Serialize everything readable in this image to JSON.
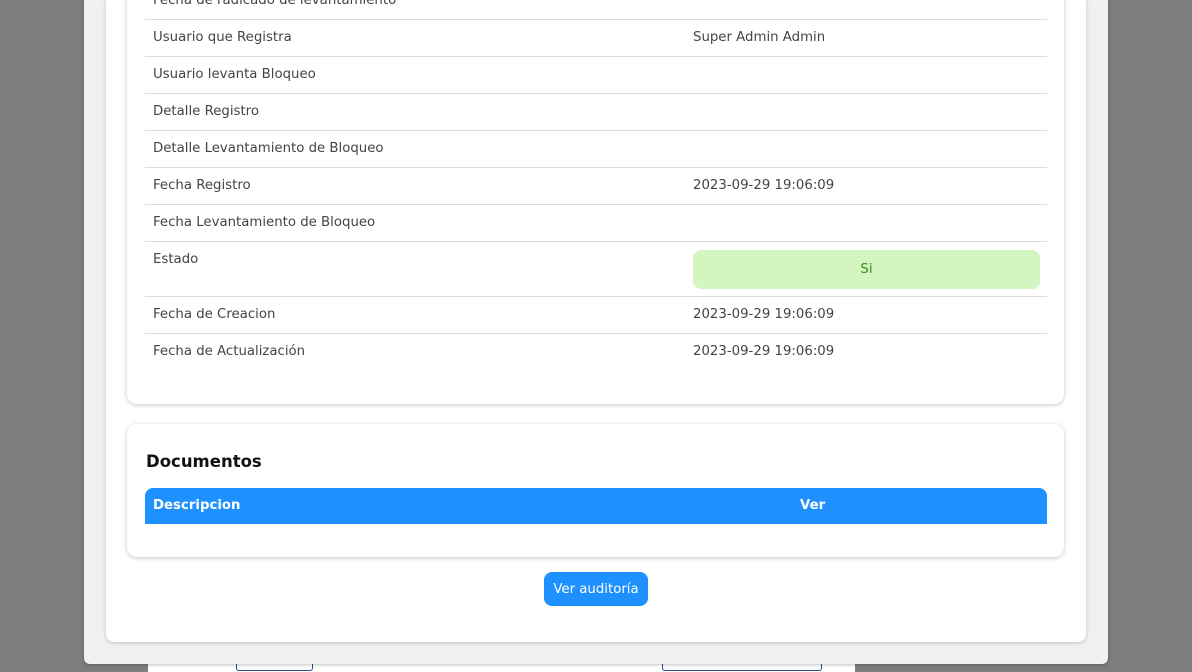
{
  "details": {
    "rows": [
      {
        "label": "Fecha de radicado de levantamiento",
        "value": ""
      },
      {
        "label": "Usuario que Registra",
        "value": "Super Admin Admin"
      },
      {
        "label": "Usuario levanta Bloqueo",
        "value": ""
      },
      {
        "label": "Detalle Registro",
        "value": ""
      },
      {
        "label": "Detalle Levantamiento de Bloqueo",
        "value": ""
      },
      {
        "label": "Fecha Registro",
        "value": "2023-09-29 19:06:09"
      },
      {
        "label": "Fecha Levantamiento de Bloqueo",
        "value": ""
      },
      {
        "label": "Estado",
        "value": "Si"
      },
      {
        "label": "Fecha de Creacion",
        "value": "2023-09-29 19:06:09"
      },
      {
        "label": "Fecha de Actualización",
        "value": "2023-09-29 19:06:09"
      }
    ]
  },
  "documents": {
    "title": "Documentos",
    "columns": [
      "Descripcion",
      "Ver"
    ]
  },
  "actions": {
    "audit_label": "Ver auditoría"
  },
  "colors": {
    "accent": "#1e90ff",
    "status_bg": "#d3f5bf",
    "status_text": "#3c8b1a"
  }
}
